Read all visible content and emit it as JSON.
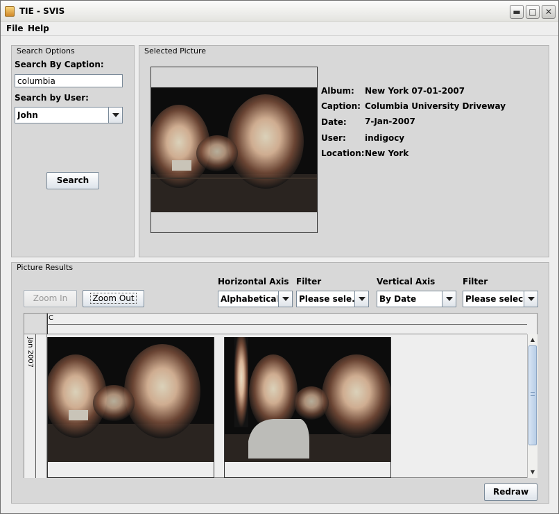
{
  "window": {
    "title": "TIE - SVIS"
  },
  "menu": {
    "items": [
      "File",
      "Help"
    ]
  },
  "search_options": {
    "title": "Search Options",
    "caption_label": "Search By Caption:",
    "caption_value": "columbia",
    "user_label": "Search by User:",
    "user_value": "John",
    "search_button": "Search"
  },
  "selected_picture": {
    "title": "Selected Picture",
    "details": [
      {
        "label": "Album:",
        "value": "New York 07-01-2007"
      },
      {
        "label": "Caption:",
        "value": "Columbia University Driveway"
      },
      {
        "label": "Date:",
        "value": "7-Jan-2007"
      },
      {
        "label": "User:",
        "value": "indigocy"
      },
      {
        "label": "Location:",
        "value": "New York"
      }
    ]
  },
  "picture_results": {
    "title": "Picture Results",
    "zoom_in": "Zoom In",
    "zoom_out": "Zoom Out",
    "horizontal_axis_label": "Horizontal Axis",
    "horizontal_axis_value": "Alphabetically",
    "filter1_label": "Filter",
    "filter1_value": "Please sele...",
    "vertical_axis_label": "Vertical Axis",
    "vertical_axis_value": "By Date",
    "filter2_label": "Filter",
    "filter2_value": "Please selec...",
    "column_header": "C",
    "row_header": "Jan 2007",
    "redraw_button": "Redraw"
  },
  "colors": {
    "panel_bg": "#d8d8d8",
    "window_bg": "#eeeeee",
    "scroll_blue": "#c6d7ea"
  }
}
